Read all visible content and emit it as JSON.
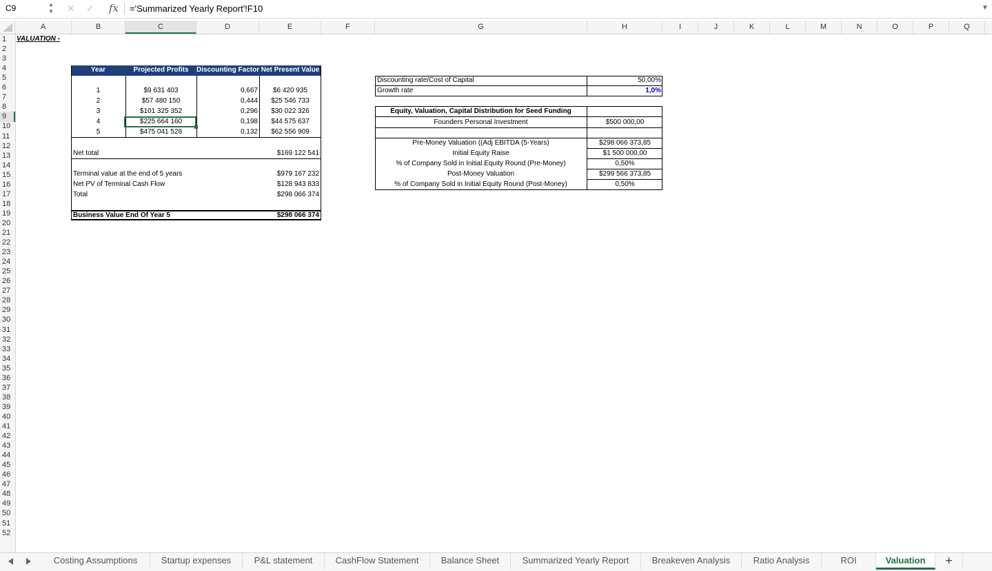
{
  "formula_bar": {
    "name_box": "C9",
    "formula": "='Summarized Yearly Report'!F10"
  },
  "columns": [
    "A",
    "B",
    "C",
    "D",
    "E",
    "F",
    "G",
    "H",
    "I",
    "J",
    "K",
    "L",
    "M",
    "N",
    "O",
    "P",
    "Q"
  ],
  "rows": [
    "1",
    "2",
    "3",
    "4",
    "5",
    "6",
    "7",
    "8",
    "9",
    "10",
    "11",
    "12",
    "13",
    "14",
    "15",
    "16",
    "17",
    "18",
    "19",
    "20",
    "21",
    "22",
    "23",
    "24",
    "25",
    "26",
    "27",
    "28",
    "29",
    "30",
    "31",
    "32",
    "33",
    "34",
    "35",
    "36",
    "37",
    "38",
    "39",
    "40",
    "41",
    "42",
    "43",
    "44",
    "45",
    "46",
    "47",
    "48",
    "49",
    "50",
    "51",
    "52"
  ],
  "sheet_title": "VALUATION -",
  "npv_table": {
    "headers": {
      "year": "Year",
      "profits": "Projected Profits",
      "factor": "Discounting Factor",
      "npv": "Net Present Value"
    },
    "rows": [
      {
        "year": "1",
        "profit": "$9 631 403",
        "factor": "0,667",
        "npv": "$6 420 935"
      },
      {
        "year": "2",
        "profit": "$57 480 150",
        "factor": "0,444",
        "npv": "$25 546 733"
      },
      {
        "year": "3",
        "profit": "$101 325 352",
        "factor": "0,296",
        "npv": "$30 022 326"
      },
      {
        "year": "4",
        "profit": "$225 664 160",
        "factor": "0,198",
        "npv": "$44 575 637"
      },
      {
        "year": "5",
        "profit": "$475 041 528",
        "factor": "0,132",
        "npv": "$62 556 909"
      }
    ],
    "net_total_label": "Net total",
    "net_total_value": "$169 122 541",
    "terminal_label": "Terminal value at the end of 5 years",
    "terminal_value": "$979 167 232",
    "net_pv_label": "Net PV of Terminal Cash Flow",
    "net_pv_value": "$128 943 833",
    "total_label": "Total",
    "total_value": "$298 066 374",
    "business_value_label": "Business Value End Of Year 5",
    "business_value_value": "$298 066 374"
  },
  "rates": {
    "discount_label": "Discounting rate/Cost of Capital",
    "discount_value": "50,00%",
    "growth_label": "Growth rate",
    "growth_value": "1,0%"
  },
  "equity": {
    "title": "Equity, Valuation, Capital Distribution for Seed Funding",
    "founders_label": "Founders Personal Investment",
    "founders_value": "$500 000,00",
    "items": [
      {
        "label": "Pre-Money Valuation ((Adj EBITDA (5-Years)",
        "value": "$298 066 373,85"
      },
      {
        "label": "Initial Equity Raise",
        "value": "$1 500 000,00"
      },
      {
        "label": "% of Company Sold in Initial Equity Round (Pre-Money)",
        "value": "0,50%"
      },
      {
        "label": "Post-Money Valuation",
        "value": "$299 566 373,85"
      },
      {
        "label": "% of Company Sold in Initial Equity Round (Post-Money)",
        "value": "0,50%"
      }
    ]
  },
  "tabs": [
    "Costing Assumptions",
    "Startup expenses",
    "P&L statement",
    "CashFlow Statement",
    "Balance Sheet",
    "Summarized Yearly Report",
    "Breakeven Analysis",
    "Ratio Analysis",
    "ROI",
    "Valuation"
  ],
  "active_tab": "Valuation",
  "add_sheet_label": "+",
  "colors": {
    "header_blue": "#1f3f7a",
    "excel_green": "#1f7244",
    "growth_blue": "#0000cc"
  }
}
